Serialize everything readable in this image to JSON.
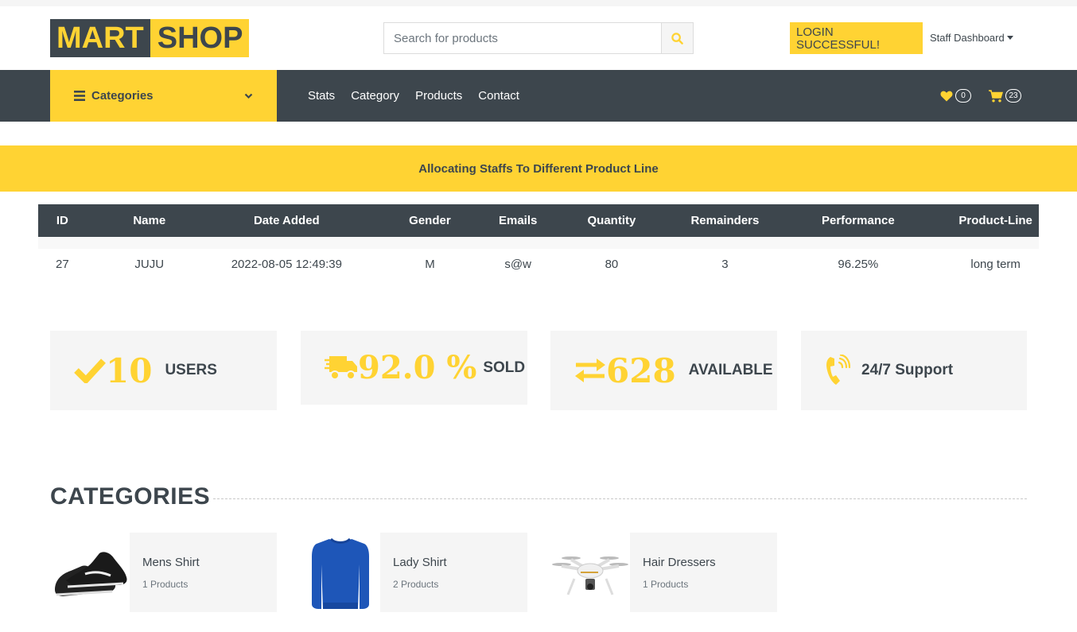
{
  "brand": {
    "part1": "MART",
    "part2": "SHOP"
  },
  "search": {
    "placeholder": "Search for products"
  },
  "header": {
    "login_status": "LOGIN SUCCESSFUL!",
    "staff_menu": "Staff Dashboard"
  },
  "nav": {
    "categories_label": "Categories",
    "links": [
      "Stats",
      "Category",
      "Products",
      "Contact"
    ],
    "wishlist_count": "0",
    "cart_count": "23"
  },
  "banner": {
    "title": "Allocating Staffs To Different Product Line"
  },
  "table": {
    "headers": [
      "ID",
      "Name",
      "Date Added",
      "Gender",
      "Emails",
      "Quantity",
      "Remainders",
      "Performance",
      "Product-Line"
    ],
    "rows": [
      [
        "27",
        "JUJU",
        "2022-08-05 12:49:39",
        "M",
        "s@w",
        "80",
        "3",
        "96.25%",
        "long term"
      ]
    ]
  },
  "stats": [
    {
      "icon": "check-icon",
      "value": "10",
      "label": "USERS"
    },
    {
      "icon": "truck-icon",
      "value": "92.0 %",
      "label": "SOLD"
    },
    {
      "icon": "exchange-icon",
      "value": "628",
      "label": "AVAILABLE"
    },
    {
      "icon": "phone-volume-icon",
      "value": "",
      "label": "24/7 Support"
    }
  ],
  "categories_section": {
    "title": "CATEGORIES",
    "items": [
      {
        "name": "Mens Shirt",
        "count": "1 Products",
        "image": "shoes-image"
      },
      {
        "name": "Lady Shirt",
        "count": "2 Products",
        "image": "sweater-image"
      },
      {
        "name": "Hair Dressers",
        "count": "1 Products",
        "image": "drone-image"
      }
    ]
  },
  "colors": {
    "accent": "#ffd333",
    "dark": "#3d464d",
    "light": "#f5f5f5"
  }
}
